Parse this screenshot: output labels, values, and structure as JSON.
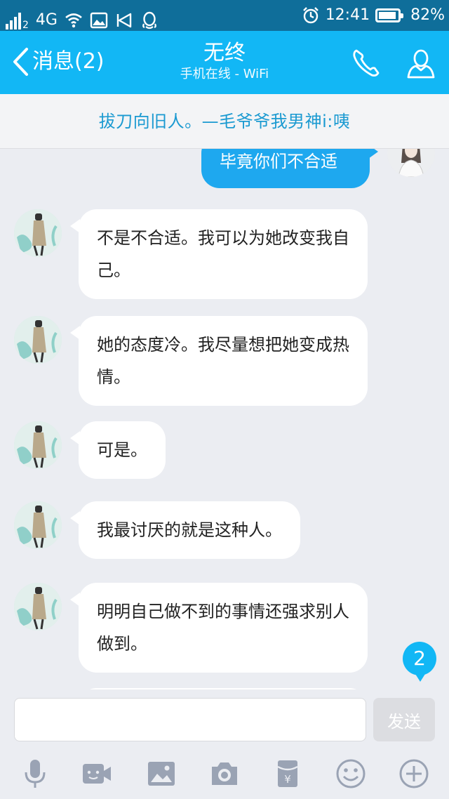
{
  "status_bar": {
    "sim_index": "2",
    "network": "4G",
    "time": "12:41",
    "battery": "82%"
  },
  "header": {
    "back_label": "消息(2)",
    "contact_name": "无终",
    "contact_status": "手机在线 - WiFi"
  },
  "banner": {
    "text": "拔刀向旧人。—毛爷爷我男神i:咦"
  },
  "messages": [
    {
      "direction": "outgoing",
      "text": "毕竟你们不合适"
    },
    {
      "direction": "incoming",
      "text": "不是不合适。我可以为她改变我自己。"
    },
    {
      "direction": "incoming",
      "text": "她的态度冷。我尽量想把她变成热情。"
    },
    {
      "direction": "incoming",
      "text": "可是。"
    },
    {
      "direction": "incoming",
      "text": "我最讨厌的就是这种人。"
    },
    {
      "direction": "incoming",
      "text": "明明自己做不到的事情还强求别人做到。"
    }
  ],
  "unread_badge": "2",
  "composer": {
    "value": "",
    "send_label": "发送"
  },
  "toolbar": [
    "mic-icon",
    "video-call-icon",
    "image-icon",
    "camera-icon",
    "red-packet-icon",
    "emoji-icon",
    "plus-icon"
  ],
  "colors": {
    "accent": "#12b7f5",
    "status_bar": "#0f6e9a",
    "outgoing_bubble": "#1ea8ef",
    "background": "#ebedf2"
  }
}
